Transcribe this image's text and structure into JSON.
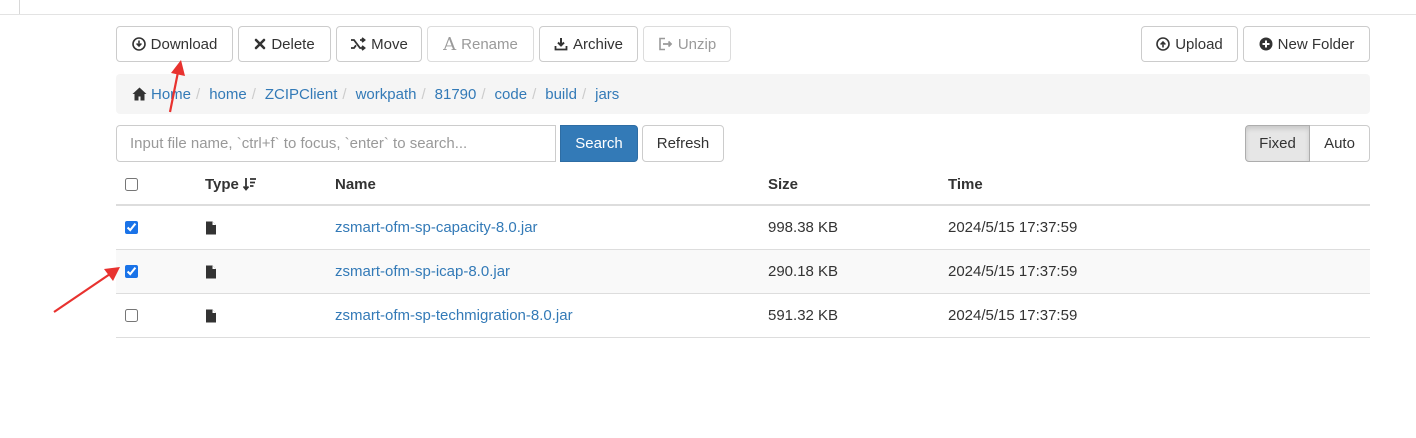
{
  "toolbar": {
    "download": "Download",
    "delete": "Delete",
    "move": "Move",
    "rename": "Rename",
    "archive": "Archive",
    "unzip": "Unzip",
    "upload": "Upload",
    "new_folder": "New Folder"
  },
  "breadcrumb": {
    "items": [
      "Home",
      "home",
      "ZCIPClient",
      "workpath",
      "81790",
      "code",
      "build",
      "jars"
    ],
    "separator": "/"
  },
  "search": {
    "placeholder": "Input file name, `ctrl+f` to focus, `enter` to search...",
    "value": "",
    "search_label": "Search",
    "refresh_label": "Refresh"
  },
  "width_mode": {
    "fixed_label": "Fixed",
    "auto_label": "Auto",
    "selected": "Fixed"
  },
  "table": {
    "columns": {
      "type": "Type",
      "name": "Name",
      "size": "Size",
      "time": "Time"
    },
    "rows": [
      {
        "checked": true,
        "type_icon": "file-icon",
        "name": "zsmart-ofm-sp-capacity-8.0.jar",
        "size": "998.38 KB",
        "time": "2024/5/15 17:37:59"
      },
      {
        "checked": true,
        "type_icon": "file-icon",
        "name": "zsmart-ofm-sp-icap-8.0.jar",
        "size": "290.18 KB",
        "time": "2024/5/15 17:37:59"
      },
      {
        "checked": false,
        "type_icon": "file-icon",
        "name": "zsmart-ofm-sp-techmigration-8.0.jar",
        "size": "591.32 KB",
        "time": "2024/5/15 17:37:59"
      }
    ]
  },
  "colors": {
    "link": "#337ab7",
    "primary": "#337ab7",
    "annotation_arrow": "#e8322f",
    "checkbox": "#1a73e8"
  }
}
